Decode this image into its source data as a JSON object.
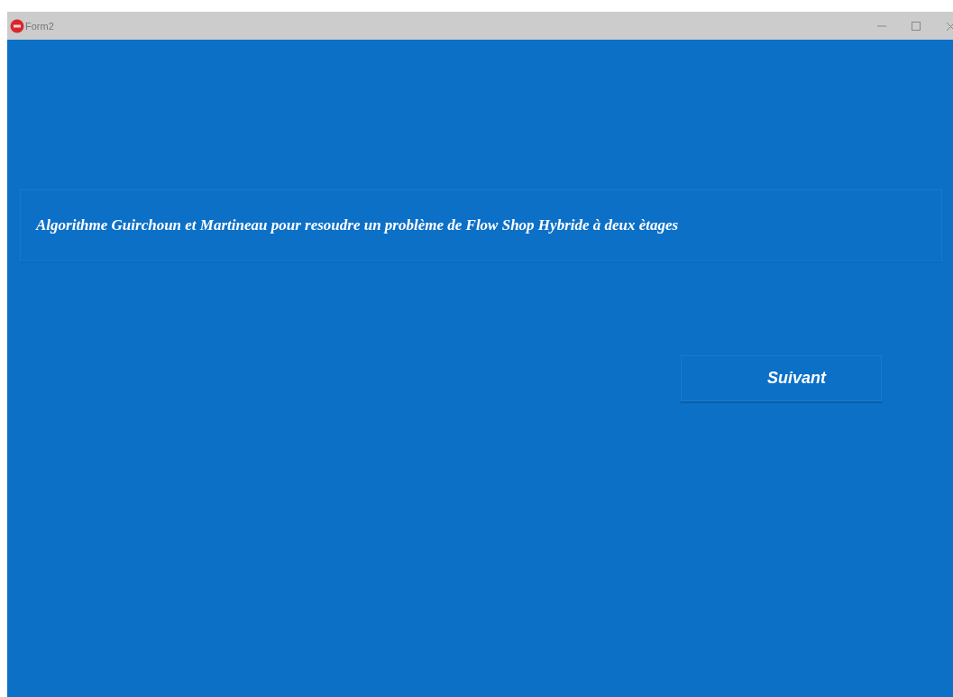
{
  "window": {
    "title": "Form2"
  },
  "heading": "Algorithme Guirchoun et Martineau pour resoudre un problème de Flow Shop Hybride à deux ètages",
  "buttons": [
    {
      "label": "Suivant"
    }
  ]
}
